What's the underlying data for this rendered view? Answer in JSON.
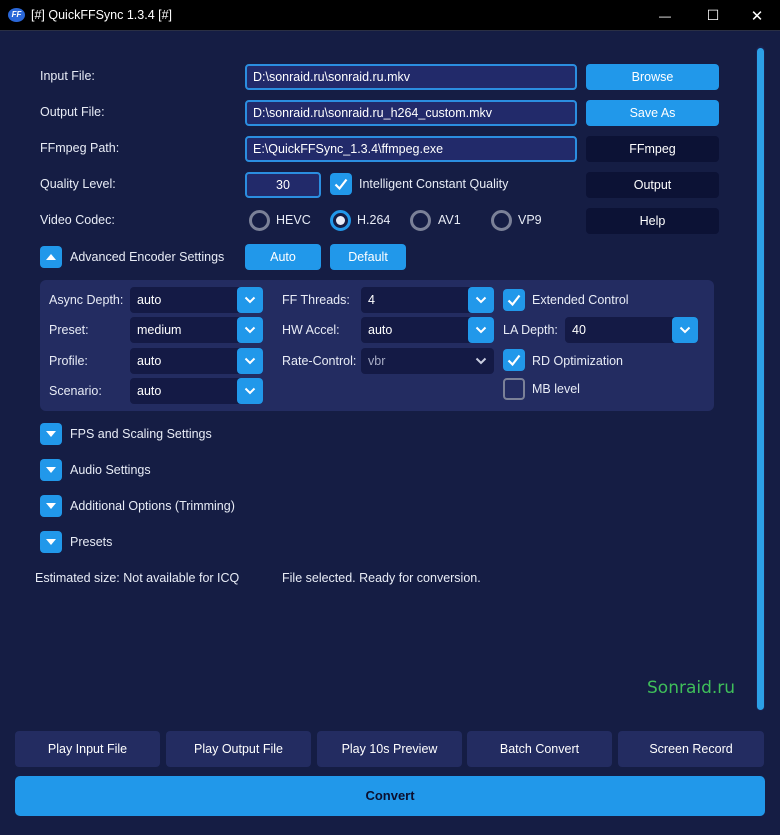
{
  "window": {
    "title": "[#] QuickFFSync 1.3.4 [#]",
    "icon_text": "FF",
    "minimize_glyph": "—",
    "maximize_glyph": "☐",
    "close_glyph": "✕"
  },
  "form": {
    "input_file_label": "Input File:",
    "input_file_value": "D:\\sonraid.ru\\sonraid.ru.mkv",
    "browse_label": "Browse",
    "output_file_label": "Output File:",
    "output_file_value": "D:\\sonraid.ru\\sonraid.ru_h264_custom.mkv",
    "save_as_label": "Save As",
    "ffmpeg_path_label": "FFmpeg Path:",
    "ffmpeg_path_value": "E:\\QuickFFSync_1.3.4\\ffmpeg.exe",
    "ffmpeg_button_label": "FFmpeg",
    "quality_label": "Quality Level:",
    "quality_value": "30",
    "icq_label": "Intelligent Constant Quality",
    "icq_checked": true,
    "output_button_label": "Output",
    "codec_label": "Video Codec:",
    "codecs": [
      {
        "label": "HEVC",
        "selected": false
      },
      {
        "label": "H.264",
        "selected": true
      },
      {
        "label": "AV1",
        "selected": false
      },
      {
        "label": "VP9",
        "selected": false
      }
    ],
    "help_label": "Help"
  },
  "advanced": {
    "section_label": "Advanced Encoder Settings",
    "auto_label": "Auto",
    "default_label": "Default",
    "async_depth_label": "Async Depth:",
    "async_depth_value": "auto",
    "preset_label": "Preset:",
    "preset_value": "medium",
    "profile_label": "Profile:",
    "profile_value": "auto",
    "scenario_label": "Scenario:",
    "scenario_value": "auto",
    "ff_threads_label": "FF Threads:",
    "ff_threads_value": "4",
    "hw_accel_label": "HW Accel:",
    "hw_accel_value": "auto",
    "rate_control_label": "Rate-Control:",
    "rate_control_value": "vbr",
    "extended_control_label": "Extended Control",
    "extended_control_checked": true,
    "la_depth_label": "LA Depth:",
    "la_depth_value": "40",
    "rd_optimization_label": "RD Optimization",
    "rd_optimization_checked": true,
    "mb_level_label": "MB level",
    "mb_level_checked": false
  },
  "sections": [
    "FPS and Scaling Settings",
    "Audio Settings",
    "Additional Options (Trimming)",
    "Presets"
  ],
  "status": {
    "estimated_size": "Estimated size: Not available for ICQ",
    "message": "File selected. Ready for conversion."
  },
  "watermark": "Sonraid.ru",
  "bottom_buttons": [
    "Play Input File",
    "Play Output File",
    "Play 10s Preview",
    "Batch Convert",
    "Screen Record"
  ],
  "convert_label": "Convert",
  "colors": {
    "background": "#151d44",
    "accent": "#2198ea",
    "panel": "#232c61",
    "watermark": "#3fbf5a"
  }
}
